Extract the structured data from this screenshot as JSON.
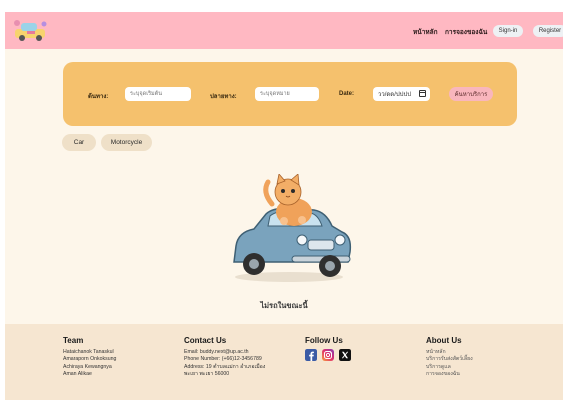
{
  "header": {
    "nav": [
      "หน้าหลัก",
      "การจองของฉัน"
    ],
    "signin_label": "Sign-in",
    "register_label": "Register",
    "bg_color": "#ffb8c2"
  },
  "search": {
    "origin_label": "ต้นทาง:",
    "origin_placeholder": "ระบุจุดเริ่มต้น",
    "destination_label": "ปลายทาง:",
    "destination_placeholder": "ระบุจุดหมาย",
    "date_label": "Date:",
    "date_value": "วว/ดด/ปปปป",
    "search_button": "ค้นหาบริการ",
    "panel_color": "#f5c16d"
  },
  "filters": [
    "Car",
    "Motorcycle"
  ],
  "empty_state": {
    "message": "ไม่รถในขณะนี้",
    "icon": "cat-driving-car-illustration"
  },
  "footer": {
    "team": {
      "title": "Team",
      "members": [
        "Hataichanok Tanaskul",
        "Amaraporn Onkoksung",
        "Achiraya Kewangnya",
        "Aman Alikae"
      ]
    },
    "contact": {
      "title": "Contact Us",
      "email": "Email: buddy.next@up.ac.th",
      "phone": "Phone Number: (+66)12-3456789",
      "address_line1": "Address: 19 ตำบลแม่กา อำเภอเมือง",
      "address_line2": "พะเยา พะเยา 56000"
    },
    "follow": {
      "title": "Follow Us",
      "icons": [
        "facebook-icon",
        "instagram-icon",
        "x-icon"
      ]
    },
    "about": {
      "title": "About Us",
      "links": [
        "หน้าหลัก",
        "บริการรับส่งสัตว์เลี้ยง",
        "บริการดูแล",
        "การจองของฉัน"
      ]
    },
    "bg_color": "#f6e6d1"
  }
}
